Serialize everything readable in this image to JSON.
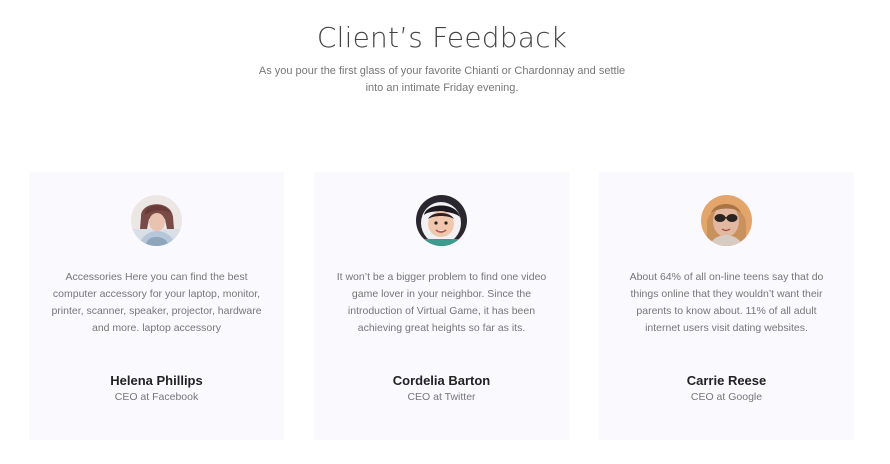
{
  "header": {
    "title": "Client’s Feedback",
    "subtitle": "As you pour the first glass of your favorite Chianti or Chardonnay and settle into an intimate Friday evening."
  },
  "testimonials": [
    {
      "avatar_icon": "portrait-woman-short-hair",
      "quote": "Accessories Here you can find the best computer accessory for your laptop, monitor, printer, scanner, speaker, projector, hardware and more. laptop accessory",
      "name": "Helena Phillips",
      "role": "CEO at Facebook"
    },
    {
      "avatar_icon": "portrait-child-hood",
      "quote": "It won’t be a bigger problem to find one video game lover in your neighbor. Since the introduction of Virtual Game, it has been achieving great heights so far as its.",
      "name": "Cordelia Barton",
      "role": "CEO at Twitter"
    },
    {
      "avatar_icon": "portrait-woman-sunglasses",
      "quote": "About 64% of all on-line teens say that do things online that they wouldn’t want their parents to know about. 11% of all adult internet users visit dating websites.",
      "name": "Carrie Reese",
      "role": "CEO at Google"
    }
  ],
  "colors": {
    "card_background": "#f9f9fe",
    "title": "#444444",
    "body_text": "#777777",
    "name_text": "#222222"
  }
}
